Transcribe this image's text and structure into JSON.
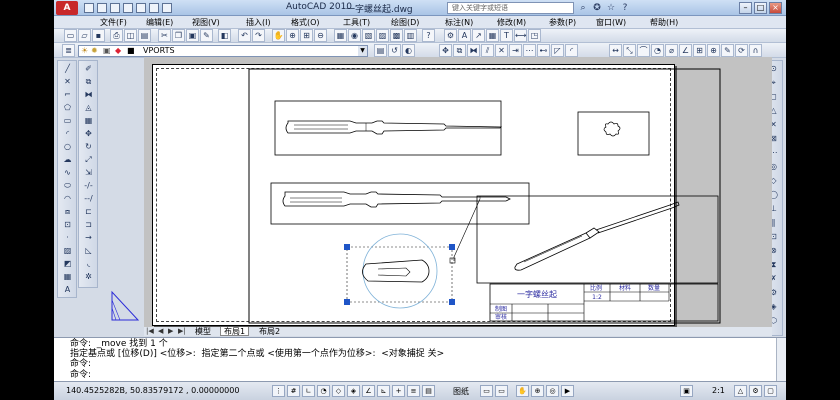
{
  "window": {
    "app_title": "AutoCAD 2010",
    "doc_title": "一字螺丝起.dwg",
    "search_placeholder": "键入关键字或短语"
  },
  "menu": [
    "文件(F)",
    "编辑(E)",
    "视图(V)",
    "插入(I)",
    "格式(O)",
    "工具(T)",
    "绘图(D)",
    "标注(N)",
    "修改(M)",
    "参数(P)",
    "窗口(W)",
    "帮助(H)"
  ],
  "layer_toolbar": {
    "current_layer": "VPORTS"
  },
  "drawing": {
    "title_block": {
      "name": "一字螺丝起",
      "headers": [
        "比例",
        "材料",
        "数量"
      ],
      "scale_value": "1:2",
      "drawn_label": "制图",
      "checked_label": "审核"
    }
  },
  "layout_tabs": [
    {
      "label": "模型",
      "active": false
    },
    {
      "label": "布局1",
      "active": true
    },
    {
      "label": "布局2",
      "active": false
    }
  ],
  "command": {
    "line1": "命令:  _move 找到 1 个",
    "line2": "指定基点或 [位移(D)] <位移>:  指定第二个点或 <使用第一个点作为位移>:  <对象捕捉 关>",
    "line3": "命令:",
    "line4": "命令:"
  },
  "status": {
    "coords": "140.4525282B, 50.8357917​2 , 0.00000000",
    "paper_label": "图纸",
    "scale": "2:1"
  }
}
